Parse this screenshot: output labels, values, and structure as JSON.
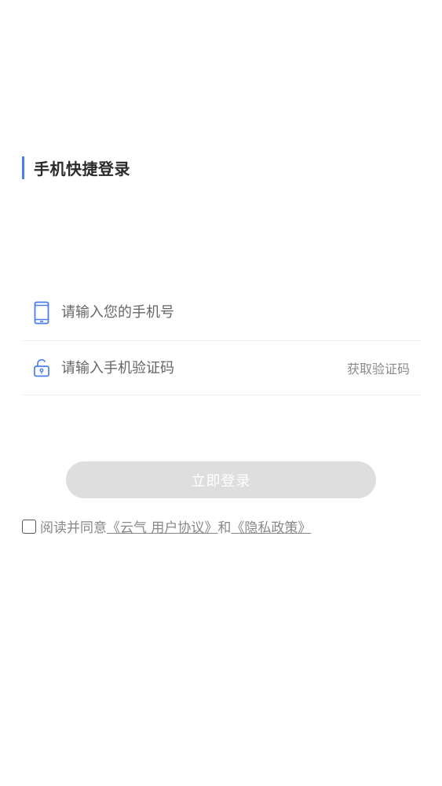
{
  "header": {
    "title": "手机快捷登录",
    "accent_color": "#4a7ef0"
  },
  "phone_field": {
    "icon": "mobile-phone-icon",
    "placeholder": "请输入您的手机号",
    "value": ""
  },
  "code_field": {
    "icon": "unlock-icon",
    "placeholder": "请输入手机验证码",
    "value": "",
    "get_code_label": "获取验证码"
  },
  "login_button": {
    "label": "立即登录",
    "background": "#dedede"
  },
  "agreement": {
    "checked": false,
    "prefix": "阅读并同意",
    "user_agreement": "《云气 用户协议》",
    "conjunction": "和",
    "privacy_policy": "《隐私政策》"
  }
}
